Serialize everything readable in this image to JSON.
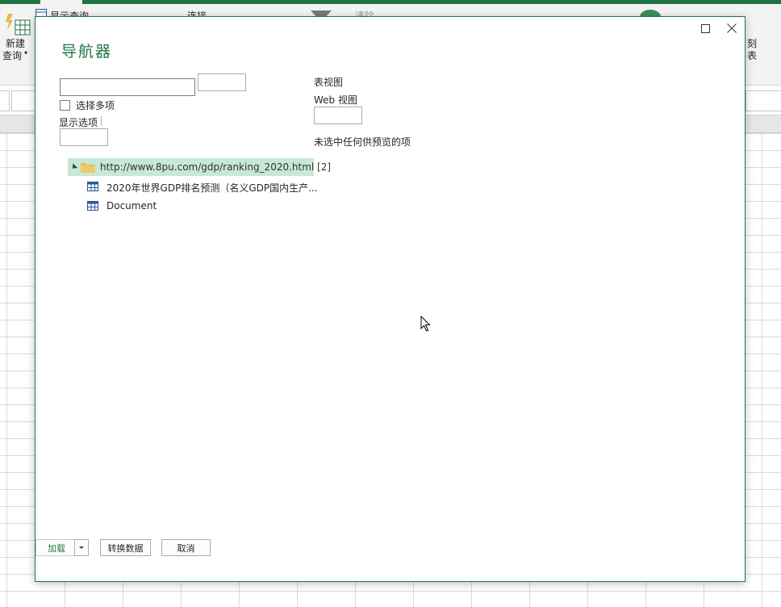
{
  "excel": {
    "ribbon": {
      "new_query_line1": "新建",
      "new_query_line2": "查询",
      "show_queries": "显示查询",
      "connections": "连接",
      "clear": "清除",
      "right_frag_1": "刻",
      "right_frag_2": "表"
    }
  },
  "dialog": {
    "title": "导航器",
    "search": {
      "value": "",
      "placeholder": ""
    },
    "select_multiple_label": "选择多项",
    "select_multiple_checked": false,
    "display_options_label": "显示选项",
    "tree": {
      "root": {
        "label": "http://www.8pu.com/gdp/ranking_2020.html [2]",
        "expanded": true,
        "icon": "folder-icon"
      },
      "children": [
        {
          "label": "2020年世界GDP排名预测（名义GDP国内生产...",
          "icon": "table-icon"
        },
        {
          "label": "Document",
          "icon": "table-icon"
        }
      ]
    },
    "preview": {
      "table_view_label": "表视图",
      "web_view_label": "Web 视图",
      "empty_message": "未选中任何供预览的项"
    },
    "buttons": {
      "load": "加载",
      "transform": "转换数据",
      "cancel": "取消"
    }
  },
  "colors": {
    "accent": "#217346",
    "selection": "#c6e8d6",
    "folder": "#e8b954"
  }
}
